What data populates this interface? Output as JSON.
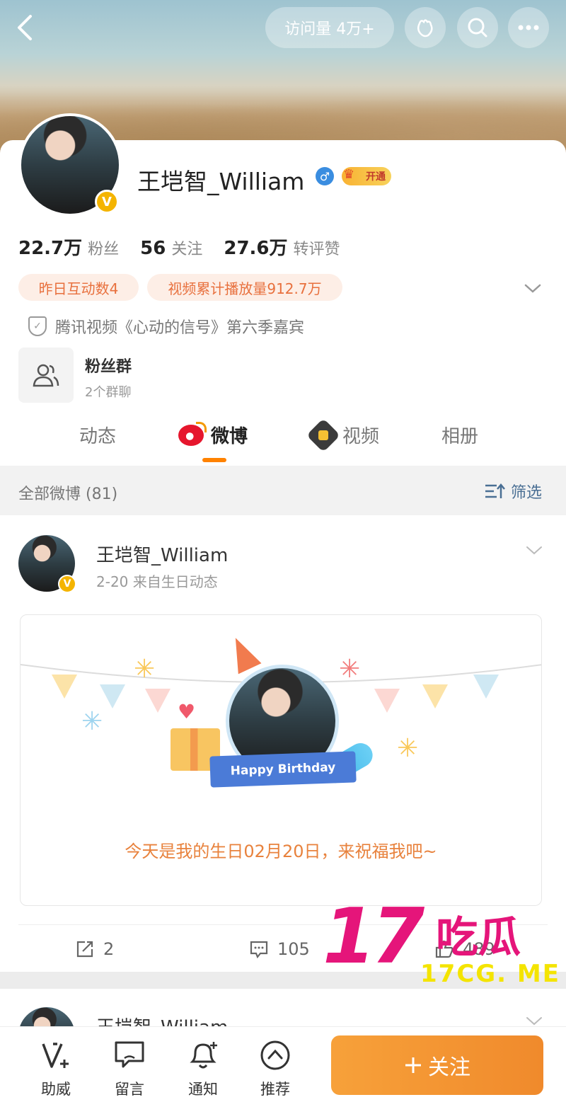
{
  "header": {
    "visits_label": "访问量 4万+",
    "back_icon": "back-icon",
    "icons": [
      "fortune-icon",
      "search-icon",
      "more-icon"
    ]
  },
  "profile": {
    "name": "王垲智_William",
    "gender_symbol": "♂",
    "verified_symbol": "V",
    "vip_label": "开通",
    "stats": [
      {
        "num": "22.7万",
        "label": "粉丝"
      },
      {
        "num": "56",
        "label": "关注"
      },
      {
        "num": "27.6万",
        "label": "转评赞"
      }
    ],
    "chips": [
      "昨日互动数4",
      "视频累计播放量912.7万"
    ],
    "guest_note": "腾讯视频《心动的信号》第六季嘉宾",
    "fan_group": {
      "title": "粉丝群",
      "subtitle": "2个群聊"
    }
  },
  "tabs": [
    {
      "label": "动态",
      "active": false
    },
    {
      "label": "微博",
      "active": true
    },
    {
      "label": "视频",
      "active": false
    },
    {
      "label": "相册",
      "active": false
    }
  ],
  "filter": {
    "all_label": "全部微博 (81)",
    "screen_label": "筛选"
  },
  "post": {
    "author": "王垲智_William",
    "meta": "2-20  来自生日动态",
    "card_banner": "Happy Birthday",
    "card_text": "今天是我的生日02月20日，来祝福我吧~",
    "reposts": "2",
    "comments": "105",
    "likes": "489"
  },
  "post2": {
    "author": "王垲智_William"
  },
  "bottom_bar": {
    "items": [
      "助威",
      "留言",
      "通知",
      "推荐"
    ],
    "follow_label": "关注"
  },
  "watermark": {
    "number": "17",
    "chinese": "吃瓜",
    "domain": "17CG. ME"
  },
  "colors": {
    "accent": "#ff8200",
    "follow_bg": "#f08a2c",
    "chip_text": "#e8703d",
    "watermark": "#e5157a"
  }
}
